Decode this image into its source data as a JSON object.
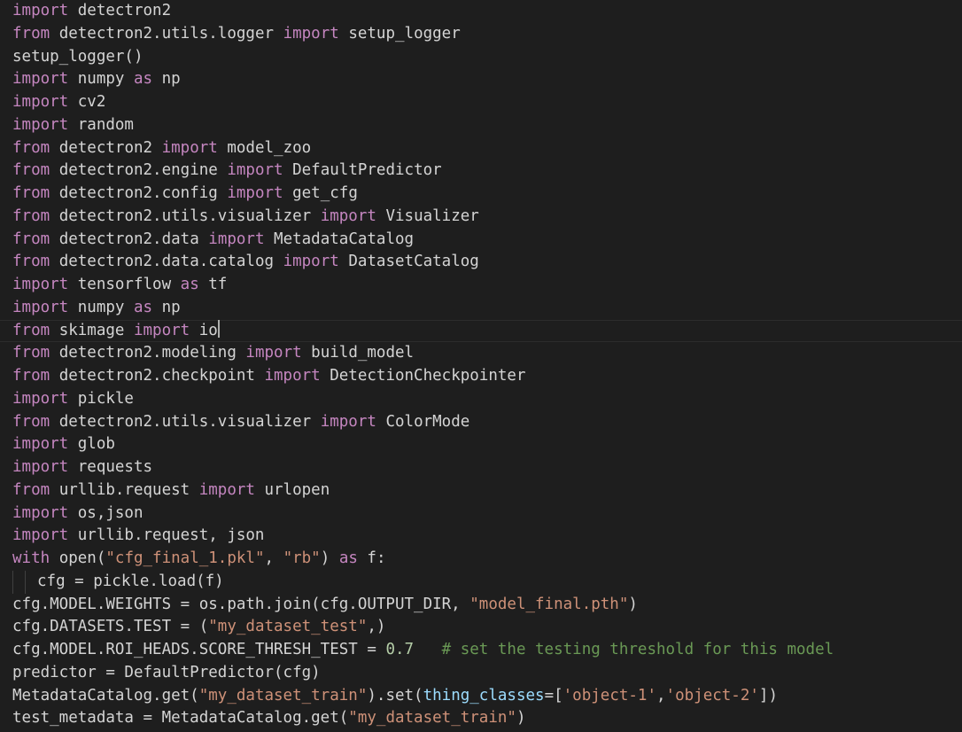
{
  "editor": {
    "language": "python",
    "current_line": 15,
    "colors": {
      "background": "#1e1e1e",
      "keyword": "#c586c0",
      "string": "#ce9178",
      "number": "#b5cea8",
      "comment": "#6a9955",
      "function": "#dcdcaa",
      "default": "#d4d4d4"
    },
    "lines": [
      [
        {
          "t": "kw",
          "v": "import"
        },
        {
          "t": "plain",
          "v": " detectron2"
        }
      ],
      [
        {
          "t": "kw",
          "v": "from"
        },
        {
          "t": "plain",
          "v": " detectron2.utils.logger "
        },
        {
          "t": "kw",
          "v": "import"
        },
        {
          "t": "plain",
          "v": " setup_logger"
        }
      ],
      [
        {
          "t": "plain",
          "v": "setup_logger()"
        }
      ],
      [
        {
          "t": "kw",
          "v": "import"
        },
        {
          "t": "plain",
          "v": " numpy "
        },
        {
          "t": "kw",
          "v": "as"
        },
        {
          "t": "plain",
          "v": " np"
        }
      ],
      [
        {
          "t": "kw",
          "v": "import"
        },
        {
          "t": "plain",
          "v": " cv2"
        }
      ],
      [
        {
          "t": "kw",
          "v": "import"
        },
        {
          "t": "plain",
          "v": " random"
        }
      ],
      [
        {
          "t": "kw",
          "v": "from"
        },
        {
          "t": "plain",
          "v": " detectron2 "
        },
        {
          "t": "kw",
          "v": "import"
        },
        {
          "t": "plain",
          "v": " model_zoo"
        }
      ],
      [
        {
          "t": "kw",
          "v": "from"
        },
        {
          "t": "plain",
          "v": " detectron2.engine "
        },
        {
          "t": "kw",
          "v": "import"
        },
        {
          "t": "plain",
          "v": " DefaultPredictor"
        }
      ],
      [
        {
          "t": "kw",
          "v": "from"
        },
        {
          "t": "plain",
          "v": " detectron2.config "
        },
        {
          "t": "kw",
          "v": "import"
        },
        {
          "t": "plain",
          "v": " get_cfg"
        }
      ],
      [
        {
          "t": "kw",
          "v": "from"
        },
        {
          "t": "plain",
          "v": " detectron2.utils.visualizer "
        },
        {
          "t": "kw",
          "v": "import"
        },
        {
          "t": "plain",
          "v": " Visualizer"
        }
      ],
      [
        {
          "t": "kw",
          "v": "from"
        },
        {
          "t": "plain",
          "v": " detectron2.data "
        },
        {
          "t": "kw",
          "v": "import"
        },
        {
          "t": "plain",
          "v": " MetadataCatalog"
        }
      ],
      [
        {
          "t": "kw",
          "v": "from"
        },
        {
          "t": "plain",
          "v": " detectron2.data.catalog "
        },
        {
          "t": "kw",
          "v": "import"
        },
        {
          "t": "plain",
          "v": " DatasetCatalog"
        }
      ],
      [
        {
          "t": "kw",
          "v": "import"
        },
        {
          "t": "plain",
          "v": " tensorflow "
        },
        {
          "t": "kw",
          "v": "as"
        },
        {
          "t": "plain",
          "v": " tf"
        }
      ],
      [
        {
          "t": "kw",
          "v": "import"
        },
        {
          "t": "plain",
          "v": " numpy "
        },
        {
          "t": "kw",
          "v": "as"
        },
        {
          "t": "plain",
          "v": " np"
        }
      ],
      [
        {
          "t": "kw",
          "v": "from"
        },
        {
          "t": "plain",
          "v": " skimage "
        },
        {
          "t": "kw",
          "v": "import"
        },
        {
          "t": "plain",
          "v": " io"
        },
        {
          "t": "cursor",
          "v": ""
        }
      ],
      [
        {
          "t": "kw",
          "v": "from"
        },
        {
          "t": "plain",
          "v": " detectron2.modeling "
        },
        {
          "t": "kw",
          "v": "import"
        },
        {
          "t": "plain",
          "v": " build_model"
        }
      ],
      [
        {
          "t": "kw",
          "v": "from"
        },
        {
          "t": "plain",
          "v": " detectron2.checkpoint "
        },
        {
          "t": "kw",
          "v": "import"
        },
        {
          "t": "plain",
          "v": " DetectionCheckpointer"
        }
      ],
      [
        {
          "t": "kw",
          "v": "import"
        },
        {
          "t": "plain",
          "v": " pickle"
        }
      ],
      [
        {
          "t": "kw",
          "v": "from"
        },
        {
          "t": "plain",
          "v": " detectron2.utils.visualizer "
        },
        {
          "t": "kw",
          "v": "import"
        },
        {
          "t": "plain",
          "v": " ColorMode"
        }
      ],
      [
        {
          "t": "kw",
          "v": "import"
        },
        {
          "t": "plain",
          "v": " glob"
        }
      ],
      [
        {
          "t": "kw",
          "v": "import"
        },
        {
          "t": "plain",
          "v": " requests"
        }
      ],
      [
        {
          "t": "kw",
          "v": "from"
        },
        {
          "t": "plain",
          "v": " urllib.request "
        },
        {
          "t": "kw",
          "v": "import"
        },
        {
          "t": "plain",
          "v": " urlopen"
        }
      ],
      [
        {
          "t": "kw",
          "v": "import"
        },
        {
          "t": "plain",
          "v": " os,json"
        }
      ],
      [
        {
          "t": "kw",
          "v": "import"
        },
        {
          "t": "plain",
          "v": " urllib.request, json"
        }
      ],
      [
        {
          "t": "kw",
          "v": "with"
        },
        {
          "t": "plain",
          "v": " open("
        },
        {
          "t": "str",
          "v": "\"cfg_final_1.pkl\""
        },
        {
          "t": "plain",
          "v": ", "
        },
        {
          "t": "str",
          "v": "\"rb\""
        },
        {
          "t": "plain",
          "v": ") "
        },
        {
          "t": "kw",
          "v": "as"
        },
        {
          "t": "plain",
          "v": " f:"
        }
      ],
      [
        {
          "t": "guide",
          "v": ""
        },
        {
          "t": "guide",
          "v": ""
        },
        {
          "t": "plain",
          "v": "cfg = pickle.load(f)"
        }
      ],
      [
        {
          "t": "plain",
          "v": "cfg.MODEL.WEIGHTS = os.path.join(cfg.OUTPUT_DIR, "
        },
        {
          "t": "str",
          "v": "\"model_final.pth\""
        },
        {
          "t": "plain",
          "v": ")"
        }
      ],
      [
        {
          "t": "plain",
          "v": "cfg.DATASETS.TEST = ("
        },
        {
          "t": "str",
          "v": "\"my_dataset_test\""
        },
        {
          "t": "plain",
          "v": ",)"
        }
      ],
      [
        {
          "t": "plain",
          "v": "cfg.MODEL.ROI_HEADS.SCORE_THRESH_TEST = "
        },
        {
          "t": "num",
          "v": "0.7"
        },
        {
          "t": "plain",
          "v": "   "
        },
        {
          "t": "cm",
          "v": "# set the testing threshold for this model"
        }
      ],
      [
        {
          "t": "plain",
          "v": "predictor = DefaultPredictor(cfg)"
        }
      ],
      [
        {
          "t": "plain",
          "v": "MetadataCatalog.get("
        },
        {
          "t": "str",
          "v": "\"my_dataset_train\""
        },
        {
          "t": "plain",
          "v": ").set("
        },
        {
          "t": "var",
          "v": "thing_classes"
        },
        {
          "t": "plain",
          "v": "=["
        },
        {
          "t": "str",
          "v": "'object-1'"
        },
        {
          "t": "plain",
          "v": ","
        },
        {
          "t": "str",
          "v": "'object-2'"
        },
        {
          "t": "plain",
          "v": "])"
        }
      ],
      [
        {
          "t": "plain",
          "v": "test_metadata = MetadataCatalog.get("
        },
        {
          "t": "str",
          "v": "\"my_dataset_train\""
        },
        {
          "t": "plain",
          "v": ")"
        }
      ]
    ]
  }
}
